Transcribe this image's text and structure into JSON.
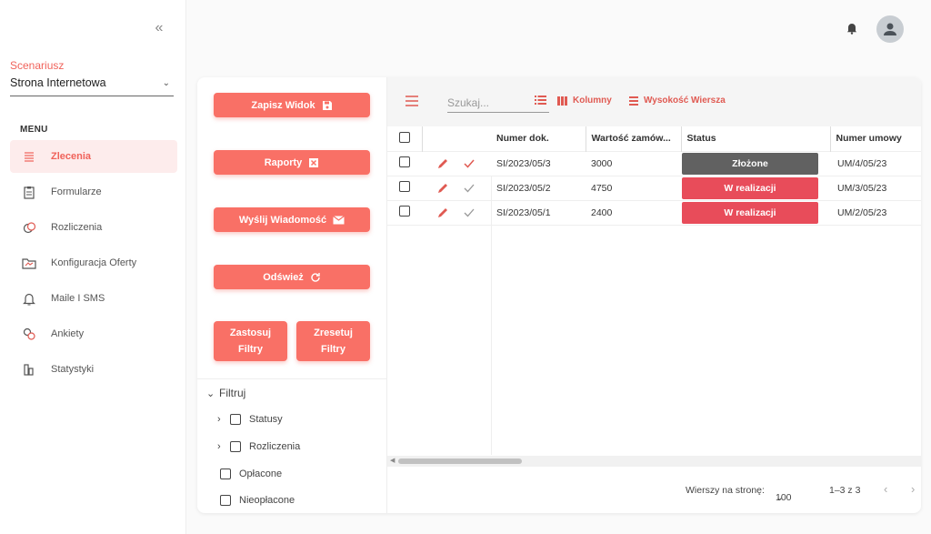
{
  "sidebar": {
    "collapse_icon": "double-chevron-left-icon",
    "scenario_label": "Scenariusz",
    "scenario_value": "Strona Internetowa",
    "menu_title": "MENU",
    "items": [
      {
        "label": "Zlecenia",
        "icon": "list-icon",
        "active": true
      },
      {
        "label": "Formularze",
        "icon": "clipboard-icon"
      },
      {
        "label": "Rozliczenia",
        "icon": "coins-icon"
      },
      {
        "label": "Konfiguracja Oferty",
        "icon": "folder-icon"
      },
      {
        "label": "Maile I SMS",
        "icon": "bell-icon"
      },
      {
        "label": "Ankiety",
        "icon": "survey-icon"
      },
      {
        "label": "Statystyki",
        "icon": "stats-icon"
      }
    ]
  },
  "actions": {
    "save_view": "Zapisz Widok",
    "reports": "Raporty",
    "send_message": "Wyślij Wiadomość",
    "refresh": "Odśwież",
    "apply_filters_1": "Zastosuj",
    "apply_filters_2": "Filtry",
    "reset_filters_1": "Zresetuj",
    "reset_filters_2": "Filtry"
  },
  "filters": {
    "title": "Filtruj",
    "items": [
      "Statusy",
      "Rozliczenia",
      "Opłacone",
      "Nieopłacone"
    ]
  },
  "toolbar": {
    "search_placeholder": "Szukaj...",
    "columns": "Kolumny",
    "row_height": "Wysokość Wiersza"
  },
  "table": {
    "headers": [
      "Numer dok.",
      "Wartość zamów...",
      "Status",
      "Numer umowy"
    ],
    "rows": [
      {
        "doc": "SI/2023/05/3",
        "value": "3000",
        "status": "Złożone",
        "status_color": "#616161",
        "contract": "UM/4/05/23"
      },
      {
        "doc": "SI/2023/05/2",
        "value": "4750",
        "status": "W realizacji",
        "status_color": "#e84c5a",
        "contract": "UM/3/05/23"
      },
      {
        "doc": "SI/2023/05/1",
        "value": "2400",
        "status": "W realizacji",
        "status_color": "#e84c5a",
        "contract": "UM/2/05/23"
      }
    ]
  },
  "footer": {
    "rows_per_page_label": "Wierszy na stronę:",
    "rows_per_page_value": "100",
    "range": "1–3 z 3"
  },
  "colors": {
    "accent": "#f97066",
    "accent_text": "#f0625a"
  }
}
